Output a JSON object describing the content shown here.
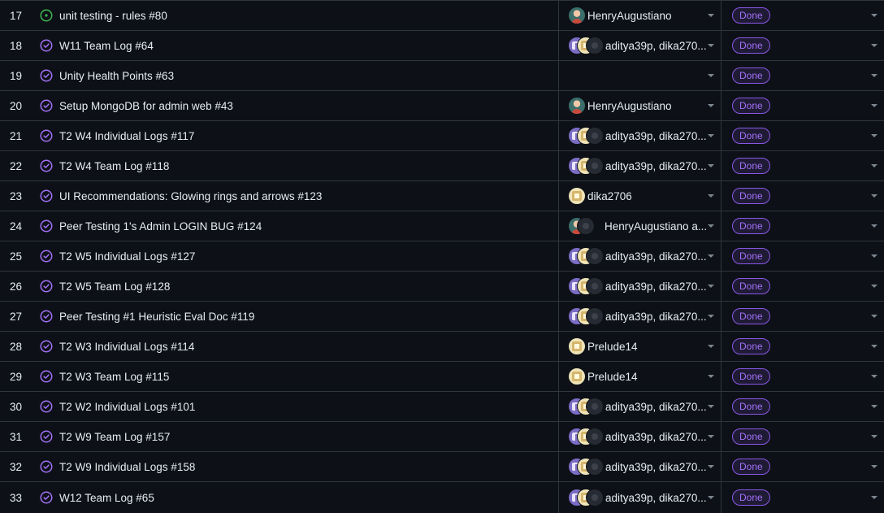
{
  "colors": {
    "background": "#0d1117",
    "border": "#30363d",
    "done_purple": "#a371f7",
    "open_green": "#3fb950",
    "text": "#e6edf3"
  },
  "rows": [
    {
      "num": "17",
      "icon": "open-circle-icon",
      "title": "unit testing - rules  #80",
      "avatars": [
        "teal"
      ],
      "assignees": "HenryAugustiano",
      "status": "Done"
    },
    {
      "num": "18",
      "icon": "check-circle-icon",
      "title": "W11 Team Log  #64",
      "avatars": [
        "purple",
        "cream",
        "dark"
      ],
      "assignees": "aditya39p, dika270...",
      "status": "Done"
    },
    {
      "num": "19",
      "icon": "check-circle-icon",
      "title": "Unity Health Points  #63",
      "avatars": [],
      "assignees": "",
      "status": "Done"
    },
    {
      "num": "20",
      "icon": "check-circle-icon",
      "title": "Setup MongoDB for admin web  #43",
      "avatars": [
        "teal"
      ],
      "assignees": "HenryAugustiano",
      "status": "Done"
    },
    {
      "num": "21",
      "icon": "check-circle-icon",
      "title": "T2 W4 Individual Logs  #117",
      "avatars": [
        "purple",
        "cream",
        "dark"
      ],
      "assignees": "aditya39p, dika270...",
      "status": "Done"
    },
    {
      "num": "22",
      "icon": "check-circle-icon",
      "title": "T2 W4 Team Log  #118",
      "avatars": [
        "purple",
        "cream",
        "dark"
      ],
      "assignees": "aditya39p, dika270...",
      "status": "Done"
    },
    {
      "num": "23",
      "icon": "check-circle-icon",
      "title": "UI Recommendations: Glowing rings and arrows  #123",
      "avatars": [
        "cream"
      ],
      "assignees": "dika2706",
      "status": "Done"
    },
    {
      "num": "24",
      "icon": "check-circle-icon",
      "title": "Peer Testing 1's Admin LOGIN BUG  #124",
      "avatars": [
        "teal",
        "dark"
      ],
      "assignees": "HenryAugustiano a...",
      "status": "Done"
    },
    {
      "num": "25",
      "icon": "check-circle-icon",
      "title": "T2 W5 Individual Logs  #127",
      "avatars": [
        "purple",
        "cream",
        "dark"
      ],
      "assignees": "aditya39p, dika270...",
      "status": "Done"
    },
    {
      "num": "26",
      "icon": "check-circle-icon",
      "title": "T2 W5 Team Log  #128",
      "avatars": [
        "purple",
        "cream",
        "dark"
      ],
      "assignees": "aditya39p, dika270...",
      "status": "Done"
    },
    {
      "num": "27",
      "icon": "check-circle-icon",
      "title": "Peer Testing #1 Heuristic Eval Doc  #119",
      "avatars": [
        "purple",
        "cream",
        "dark"
      ],
      "assignees": "aditya39p, dika270...",
      "status": "Done"
    },
    {
      "num": "28",
      "icon": "check-circle-icon",
      "title": "T2 W3 Individual Logs  #114",
      "avatars": [
        "cream"
      ],
      "assignees": "Prelude14",
      "status": "Done"
    },
    {
      "num": "29",
      "icon": "check-circle-icon",
      "title": "T2 W3 Team Log  #115",
      "avatars": [
        "cream"
      ],
      "assignees": "Prelude14",
      "status": "Done"
    },
    {
      "num": "30",
      "icon": "check-circle-icon",
      "title": "T2 W2 Individual Logs  #101",
      "avatars": [
        "purple",
        "cream",
        "dark"
      ],
      "assignees": "aditya39p, dika270...",
      "status": "Done"
    },
    {
      "num": "31",
      "icon": "check-circle-icon",
      "title": "T2 W9 Team Log  #157",
      "avatars": [
        "purple",
        "cream",
        "dark"
      ],
      "assignees": "aditya39p, dika270...",
      "status": "Done"
    },
    {
      "num": "32",
      "icon": "check-circle-icon",
      "title": "T2 W9 Individual Logs  #158",
      "avatars": [
        "purple",
        "cream",
        "dark"
      ],
      "assignees": "aditya39p, dika270...",
      "status": "Done"
    },
    {
      "num": "33",
      "icon": "check-circle-icon",
      "title": "W12 Team Log  #65",
      "avatars": [
        "purple",
        "cream",
        "dark"
      ],
      "assignees": "aditya39p, dika270...",
      "status": "Done"
    }
  ]
}
